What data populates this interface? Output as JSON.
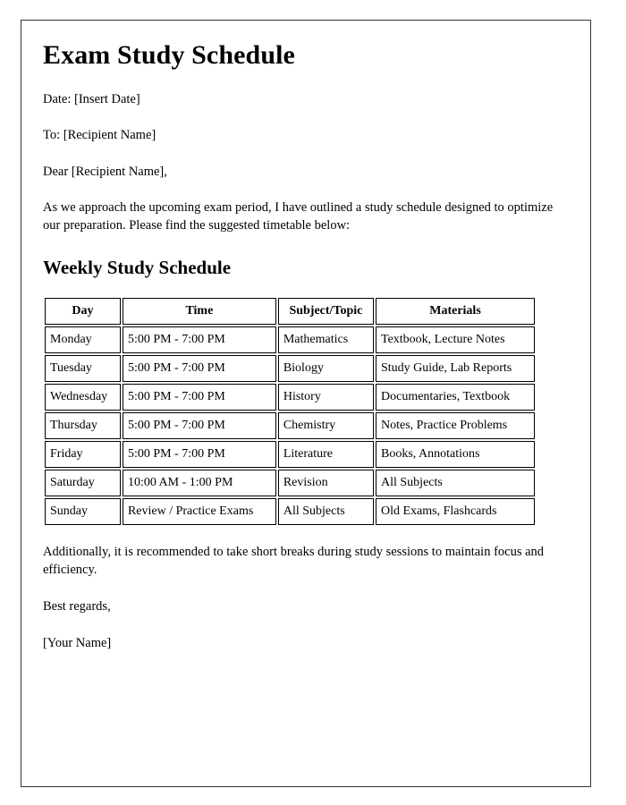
{
  "document": {
    "title": "Exam Study Schedule",
    "date_line": "Date: [Insert Date]",
    "to_line": "To: [Recipient Name]",
    "salutation": "Dear [Recipient Name],",
    "intro_paragraph": "As we approach the upcoming exam period, I have outlined a study schedule designed to optimize our preparation. Please find the suggested timetable below:",
    "section_heading": "Weekly Study Schedule",
    "closing_paragraph": "Additionally, it is recommended to take short breaks during study sessions to maintain focus and efficiency.",
    "signoff": "Best regards,",
    "signature": "[Your Name]"
  },
  "schedule_table": {
    "headers": [
      "Day",
      "Time",
      "Subject/Topic",
      "Materials"
    ],
    "rows": [
      {
        "day": "Monday",
        "time": "5:00 PM - 7:00 PM",
        "subject": "Mathematics",
        "materials": "Textbook, Lecture Notes"
      },
      {
        "day": "Tuesday",
        "time": "5:00 PM - 7:00 PM",
        "subject": "Biology",
        "materials": "Study Guide, Lab Reports"
      },
      {
        "day": "Wednesday",
        "time": "5:00 PM - 7:00 PM",
        "subject": "History",
        "materials": "Documentaries, Textbook"
      },
      {
        "day": "Thursday",
        "time": "5:00 PM - 7:00 PM",
        "subject": "Chemistry",
        "materials": "Notes, Practice Problems"
      },
      {
        "day": "Friday",
        "time": "5:00 PM - 7:00 PM",
        "subject": "Literature",
        "materials": "Books, Annotations"
      },
      {
        "day": "Saturday",
        "time": "10:00 AM - 1:00 PM",
        "subject": "Revision",
        "materials": "All Subjects"
      },
      {
        "day": "Sunday",
        "time": "Review / Practice Exams",
        "subject": "All Subjects",
        "materials": "Old Exams, Flashcards"
      }
    ]
  },
  "style": {
    "text_color": "#000000",
    "page_background": "#ffffff",
    "border_color": "#333333",
    "table_border_color": "#000000"
  }
}
